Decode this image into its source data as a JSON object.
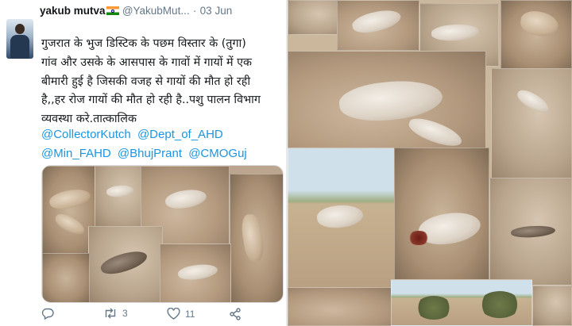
{
  "tweet": {
    "author_name": "yakub mutva",
    "author_handle": "@YakubMut...",
    "separator": "·",
    "date": "03 Jun",
    "text_lines": [
      "गुजरात के भुज डिस्टिक के पछम विस्तार के (तुगा)",
      "गांव और उसके के आसपास के गावों में  गायों में एक",
      "बीमारी हुई है जिसकी वजह से गायों की मौत हो रही",
      "है,,हर रोज गायों की मौत हो रही है..पशु पालन विभाग",
      "व्यवस्था करे.तात्कालिक"
    ],
    "mentions": [
      "@CollectorKutch",
      "@Dept_of_AHD",
      "@Min_FAHD",
      "@BhujPrant",
      "@CMOGuj"
    ],
    "actions": {
      "reply_count": "",
      "retweet_count": "3",
      "like_count": "11"
    }
  },
  "colors": {
    "link": "#1b95e0",
    "text": "#14171a",
    "muted": "#657786"
  },
  "icons": [
    "reply-icon",
    "retweet-icon",
    "like-icon",
    "share-icon",
    "india-flag-icon"
  ]
}
